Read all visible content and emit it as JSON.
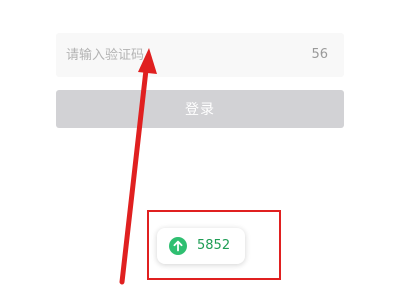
{
  "verification": {
    "code_placeholder": "请输入验证码",
    "countdown": "56"
  },
  "login": {
    "button_label": "登录"
  },
  "sms_suggestion": {
    "code": "5852",
    "icon": "arrow-up-icon"
  },
  "annotation": {
    "color": "#e02020"
  }
}
